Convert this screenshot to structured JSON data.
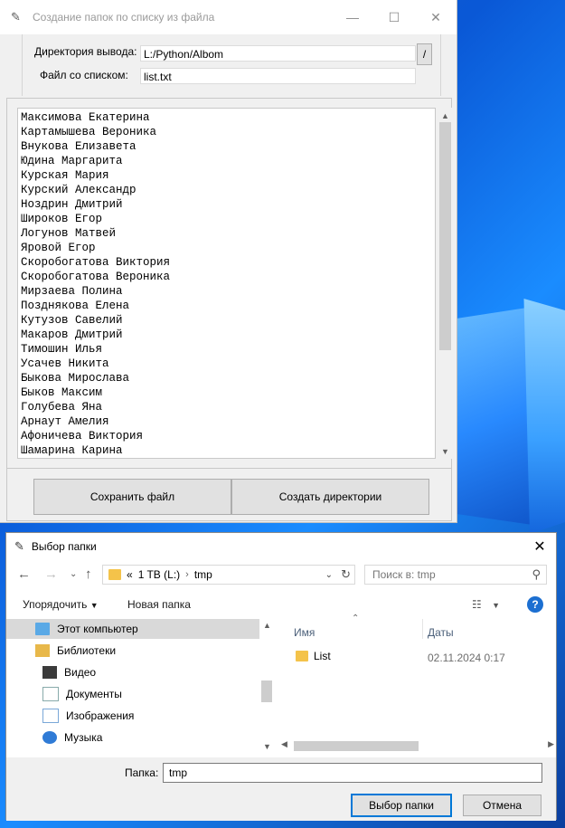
{
  "main_window": {
    "title": "Создание папок по списку из файла",
    "output_dir_label": "Директория вывода:",
    "output_dir_value": "L:/Python/Albom",
    "browse_label": "/",
    "list_file_label": "Файл со списком:",
    "list_file_value": "list.txt",
    "names": [
      "Максимова Екатерина",
      "Картамышева Вероника",
      "Внукова Елизавета",
      "Юдина Маргарита",
      "Курская Мария",
      "Курский Александр",
      "Ноздрин Дмитрий",
      "Широков Егор",
      "Логунов Матвей",
      "Яровой Егор",
      "Скоробогатова Виктория",
      "Скоробогатова Вероника",
      "Мирзаева Полина",
      "Позднякова Елена",
      "Кутузов Савелий",
      "Макаров Дмитрий",
      "Тимошин Илья",
      "Усачев Никита",
      "Быкова Мирослава",
      "Быков Максим",
      "Голубева Яна",
      "Арнаут Амелия",
      "Афоничева Виктория",
      "Шамарина Карина"
    ],
    "save_button": "Сохранить файл",
    "create_button": "Создать директории"
  },
  "folder_dialog": {
    "title": "Выбор папки",
    "address": {
      "overflow": "«",
      "drive": "1 TB (L:)",
      "folder": "tmp"
    },
    "search_placeholder": "Поиск в: tmp",
    "organize_label": "Упорядочить",
    "new_folder_label": "Новая папка",
    "nav_items": [
      {
        "label": "Этот компьютер",
        "icon": "computer-icon"
      },
      {
        "label": "Библиотеки",
        "icon": "libraries-icon"
      },
      {
        "label": "Видео",
        "icon": "video-icon"
      },
      {
        "label": "Документы",
        "icon": "documents-icon"
      },
      {
        "label": "Изображения",
        "icon": "pictures-icon"
      },
      {
        "label": "Музыка",
        "icon": "music-icon"
      }
    ],
    "columns": {
      "name": "Имя",
      "date": "Даты"
    },
    "files": [
      {
        "name": "List",
        "date": "02.11.2024 0:17"
      }
    ],
    "folder_label": "Папка:",
    "folder_value": "tmp",
    "ok_button": "Выбор папки",
    "cancel_button": "Отмена"
  },
  "colors": {
    "accent": "#0078d7",
    "folder": "#f4c34a",
    "help": "#1c6fd1"
  }
}
